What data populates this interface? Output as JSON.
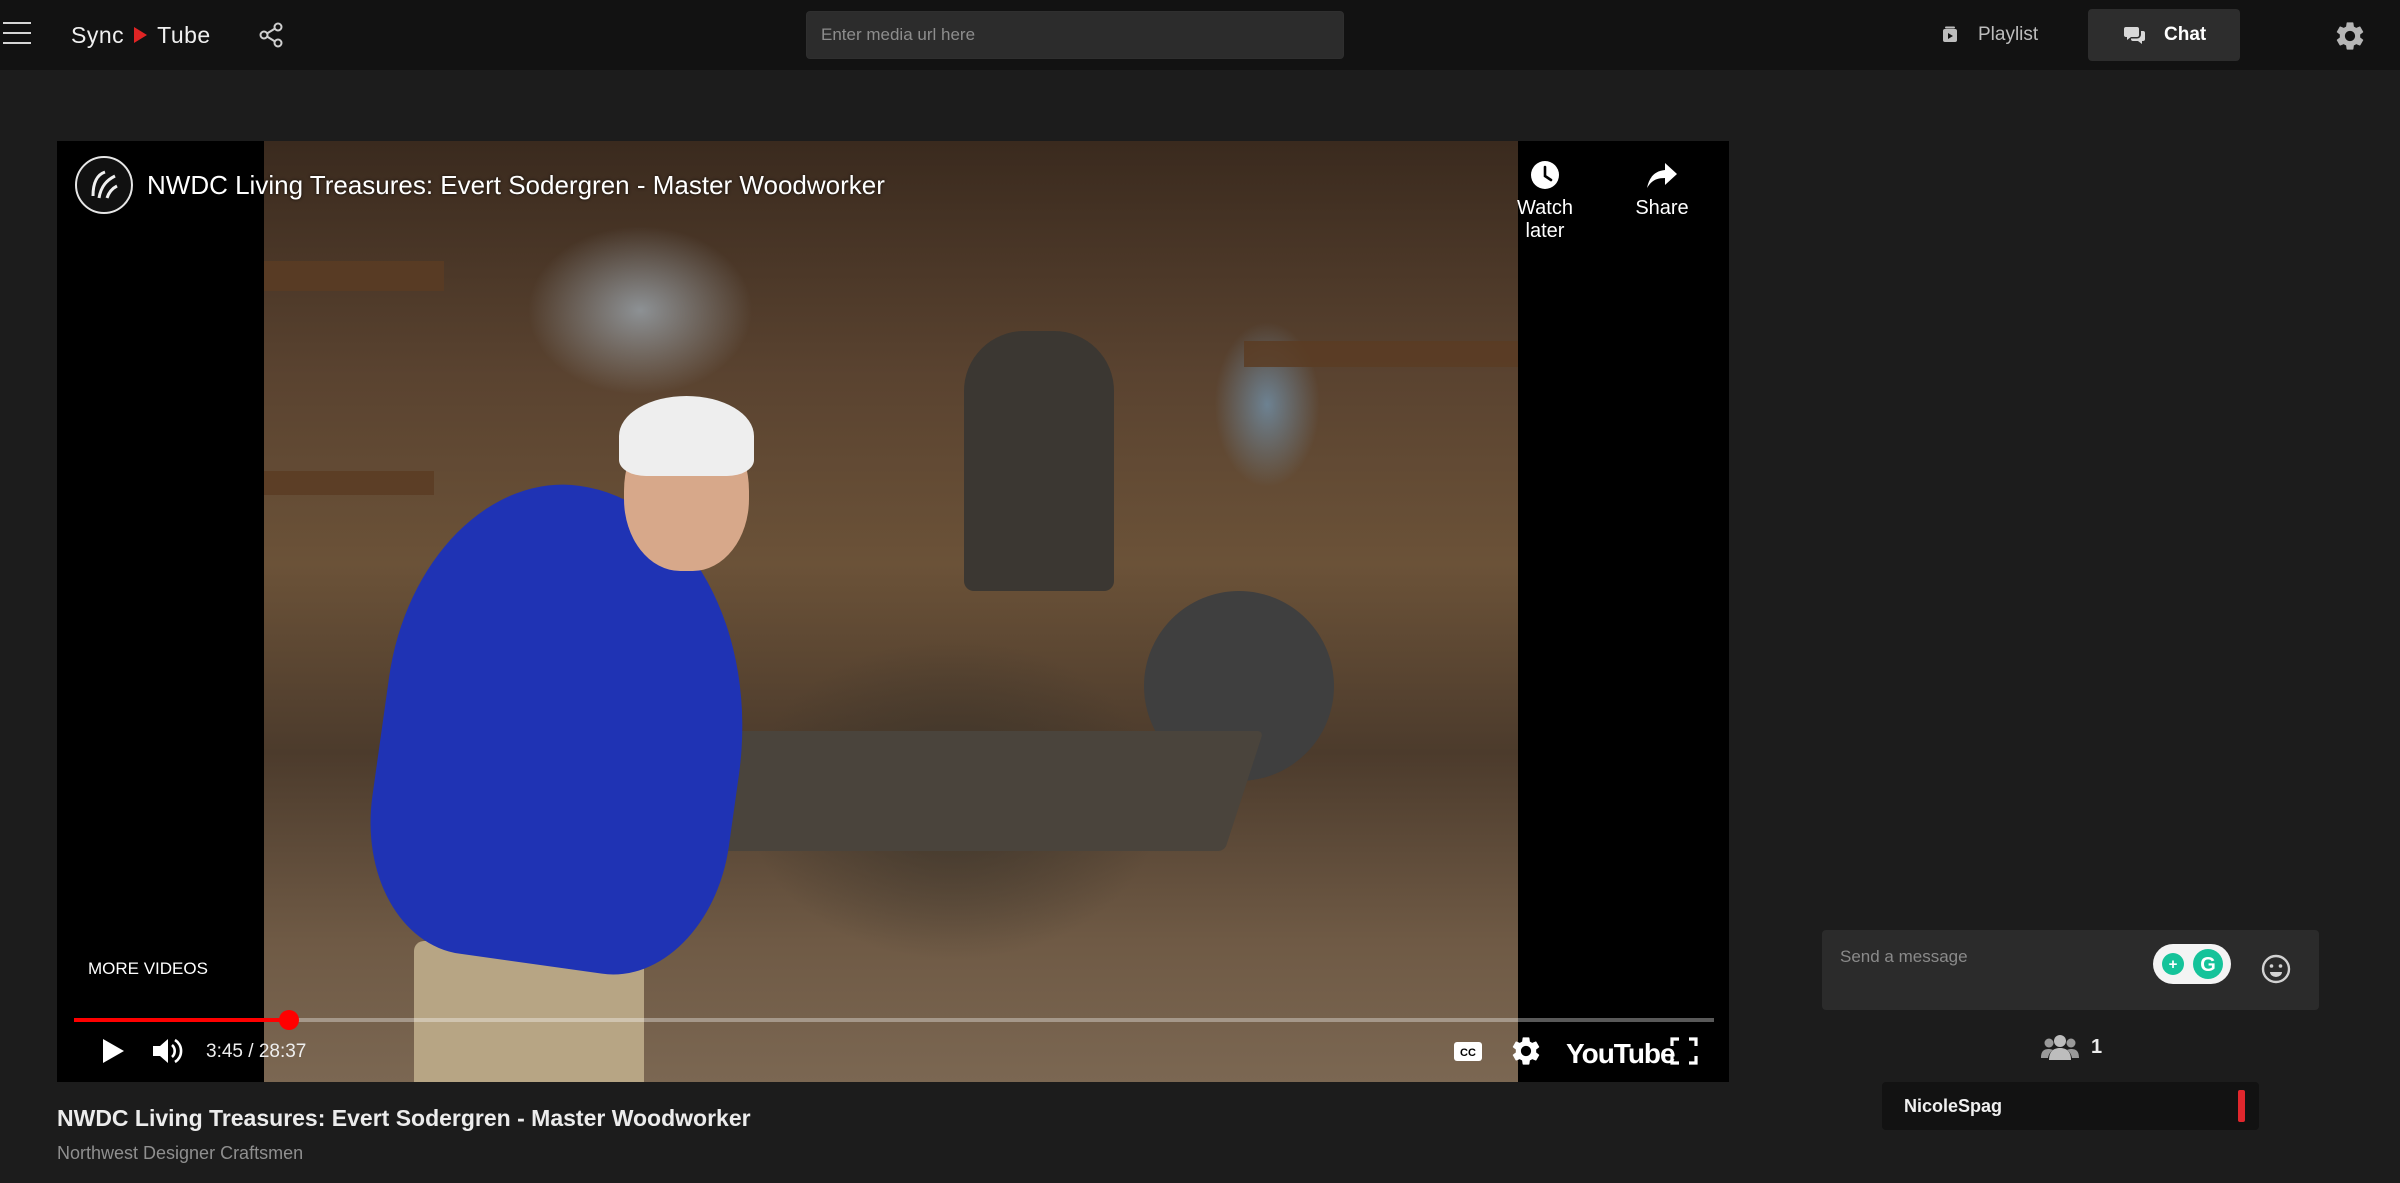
{
  "header": {
    "logo": {
      "word1": "Sync",
      "word2": "Tube"
    },
    "url_input_placeholder": "Enter media url here",
    "tabs": [
      {
        "label": "Playlist",
        "icon": "playlist-icon",
        "active": false
      },
      {
        "label": "Chat",
        "icon": "chat-icon",
        "active": true
      }
    ],
    "icons": [
      "menu-icon",
      "share-icon",
      "gear-icon"
    ]
  },
  "player": {
    "title": "NWDC Living Treasures: Evert Sodergren - Master Woodworker",
    "watch_later_label": "Watch later",
    "share_label": "Share",
    "more_videos_label": "MORE VIDEOS",
    "time_display": "3:45 / 28:37",
    "progress_fraction": 0.131,
    "brand": "YouTube",
    "controls": [
      "play-icon",
      "volume-icon",
      "captions-icon",
      "settings-icon",
      "fullscreen-icon"
    ],
    "progress_color": "#ff0000"
  },
  "video_info": {
    "title": "NWDC Living Treasures: Evert Sodergren - Master Woodworker",
    "channel": "Northwest Designer Craftsmen"
  },
  "chat": {
    "input_placeholder": "Send a message",
    "user_count": "1",
    "users": [
      {
        "name": "NicoleSpag",
        "status_color": "#e0272d"
      }
    ]
  },
  "colors": {
    "background": "#1c1c1c",
    "topbar": "#121212",
    "accent_red": "#e02424"
  }
}
